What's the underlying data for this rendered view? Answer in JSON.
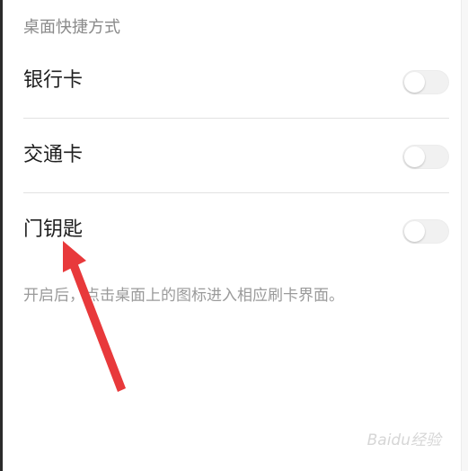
{
  "section": {
    "title": "桌面快捷方式"
  },
  "rows": [
    {
      "label": "银行卡",
      "enabled": false
    },
    {
      "label": "交通卡",
      "enabled": false
    },
    {
      "label": "门钥匙",
      "enabled": false
    }
  ],
  "footnote": "开启后，点击桌面上的图标进入相应刷卡界面。",
  "watermark": "Baidu经验",
  "colors": {
    "arrow": "#e8393b",
    "toggle_off": "#f1f1f1"
  }
}
